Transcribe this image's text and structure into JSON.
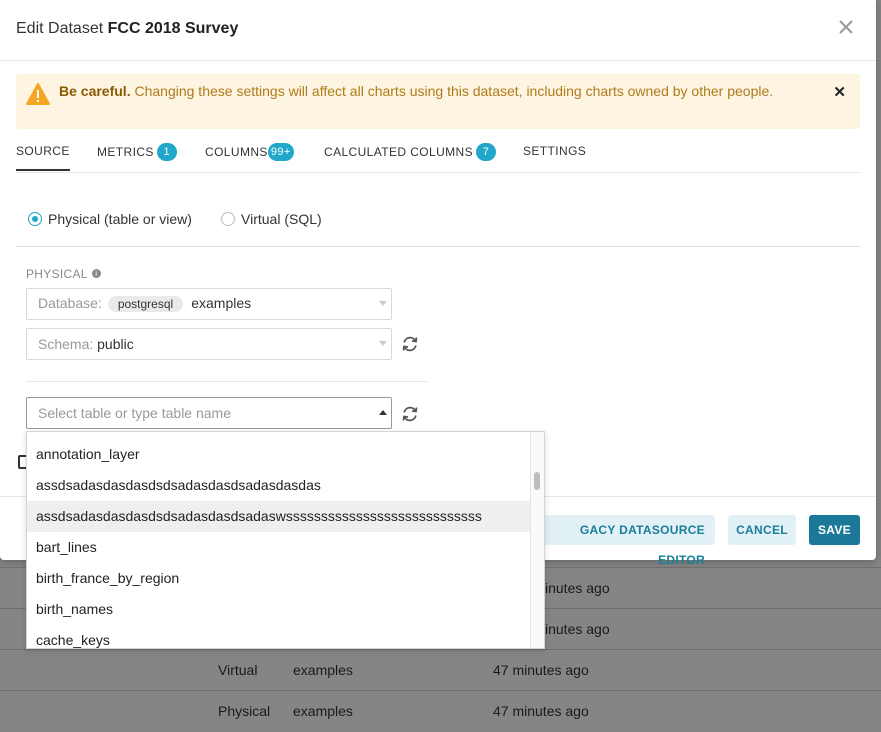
{
  "modal": {
    "title_prefix": "Edit Dataset",
    "title_name": "FCC 2018 Survey"
  },
  "alert": {
    "bold": "Be careful.",
    "text": " Changing these settings will affect all charts using this dataset, including charts owned by other people."
  },
  "tabs": [
    {
      "label": "SOURCE",
      "badge": ""
    },
    {
      "label": "METRICS",
      "badge": "1"
    },
    {
      "label": "COLUMNS",
      "badge": "99+"
    },
    {
      "label": "CALCULATED COLUMNS",
      "badge": "7"
    },
    {
      "label": "SETTINGS",
      "badge": ""
    }
  ],
  "source": {
    "physical_label": "Physical (table or view)",
    "virtual_label": "Virtual (SQL)",
    "selected": "physical",
    "section_label": "PHYSICAL",
    "database_label": "Database:",
    "database_engine": "postgresql",
    "database_name": "examples",
    "schema_label": "Schema:",
    "schema_value": "public",
    "table_placeholder": "Select table or type table name"
  },
  "dropdown": {
    "options": [
      "annotation_layer",
      "assdsadasdasdasdsdsadasdasdsadasdasdas",
      "assdsadasdasdasdsdsadasdasdsadaswssssssssssssssssssssssssssss",
      "bart_lines",
      "birth_france_by_region",
      "birth_names",
      "cache_keys"
    ],
    "highlighted_index": 2
  },
  "footer": {
    "legacy_button": "GACY DATASOURCE EDITOR",
    "cancel_button": "CANCEL",
    "save_button": "SAVE"
  },
  "background_rows": [
    {
      "type": "",
      "database": "",
      "modified": "inutes ago"
    },
    {
      "type": "",
      "database": "",
      "modified": "inutes ago"
    },
    {
      "type": "Virtual",
      "database": "examples",
      "modified": "47 minutes ago"
    },
    {
      "type": "Physical",
      "database": "examples",
      "modified": "47 minutes ago"
    }
  ],
  "colors": {
    "accent": "#20a7c9",
    "primary_button": "#1b7899",
    "alert_bg": "#fdf4e2",
    "alert_icon": "#f5a623"
  }
}
